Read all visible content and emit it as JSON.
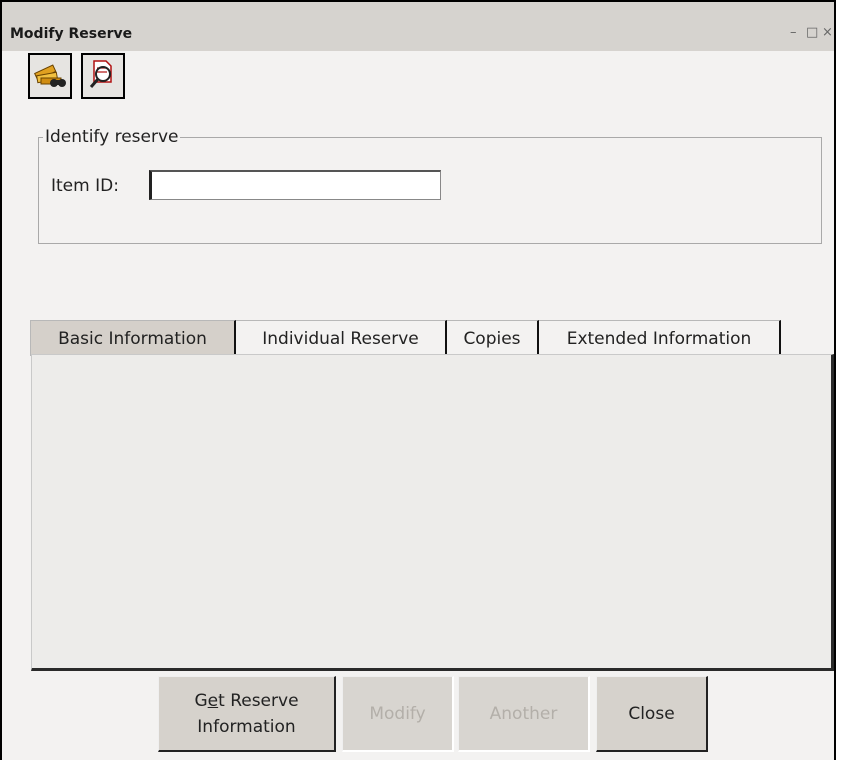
{
  "window": {
    "title": "Modify Reserve",
    "controls": {
      "minimize": "–",
      "maximize": "□",
      "close": "×"
    }
  },
  "toolbar": {
    "buttons": [
      {
        "icon": "search-item-icon"
      },
      {
        "icon": "search-reserve-icon"
      }
    ]
  },
  "identify_group": {
    "legend": "Identify reserve",
    "item_id_label": "Item ID:",
    "item_id_value": ""
  },
  "tabs": [
    {
      "label": "Basic Information",
      "active": true
    },
    {
      "label": "Individual Reserve",
      "active": false
    },
    {
      "label": "Copies",
      "active": false
    },
    {
      "label": "Extended Information",
      "active": false
    }
  ],
  "buttons": {
    "get_reserve": {
      "pre": "G",
      "mnemonic": "e",
      "post": "t Reserve",
      "line2": "Information",
      "enabled": true
    },
    "modify": {
      "label": "Modify",
      "enabled": false
    },
    "another": {
      "label": "Another",
      "enabled": false
    },
    "close": {
      "label": "Close",
      "enabled": true
    }
  }
}
